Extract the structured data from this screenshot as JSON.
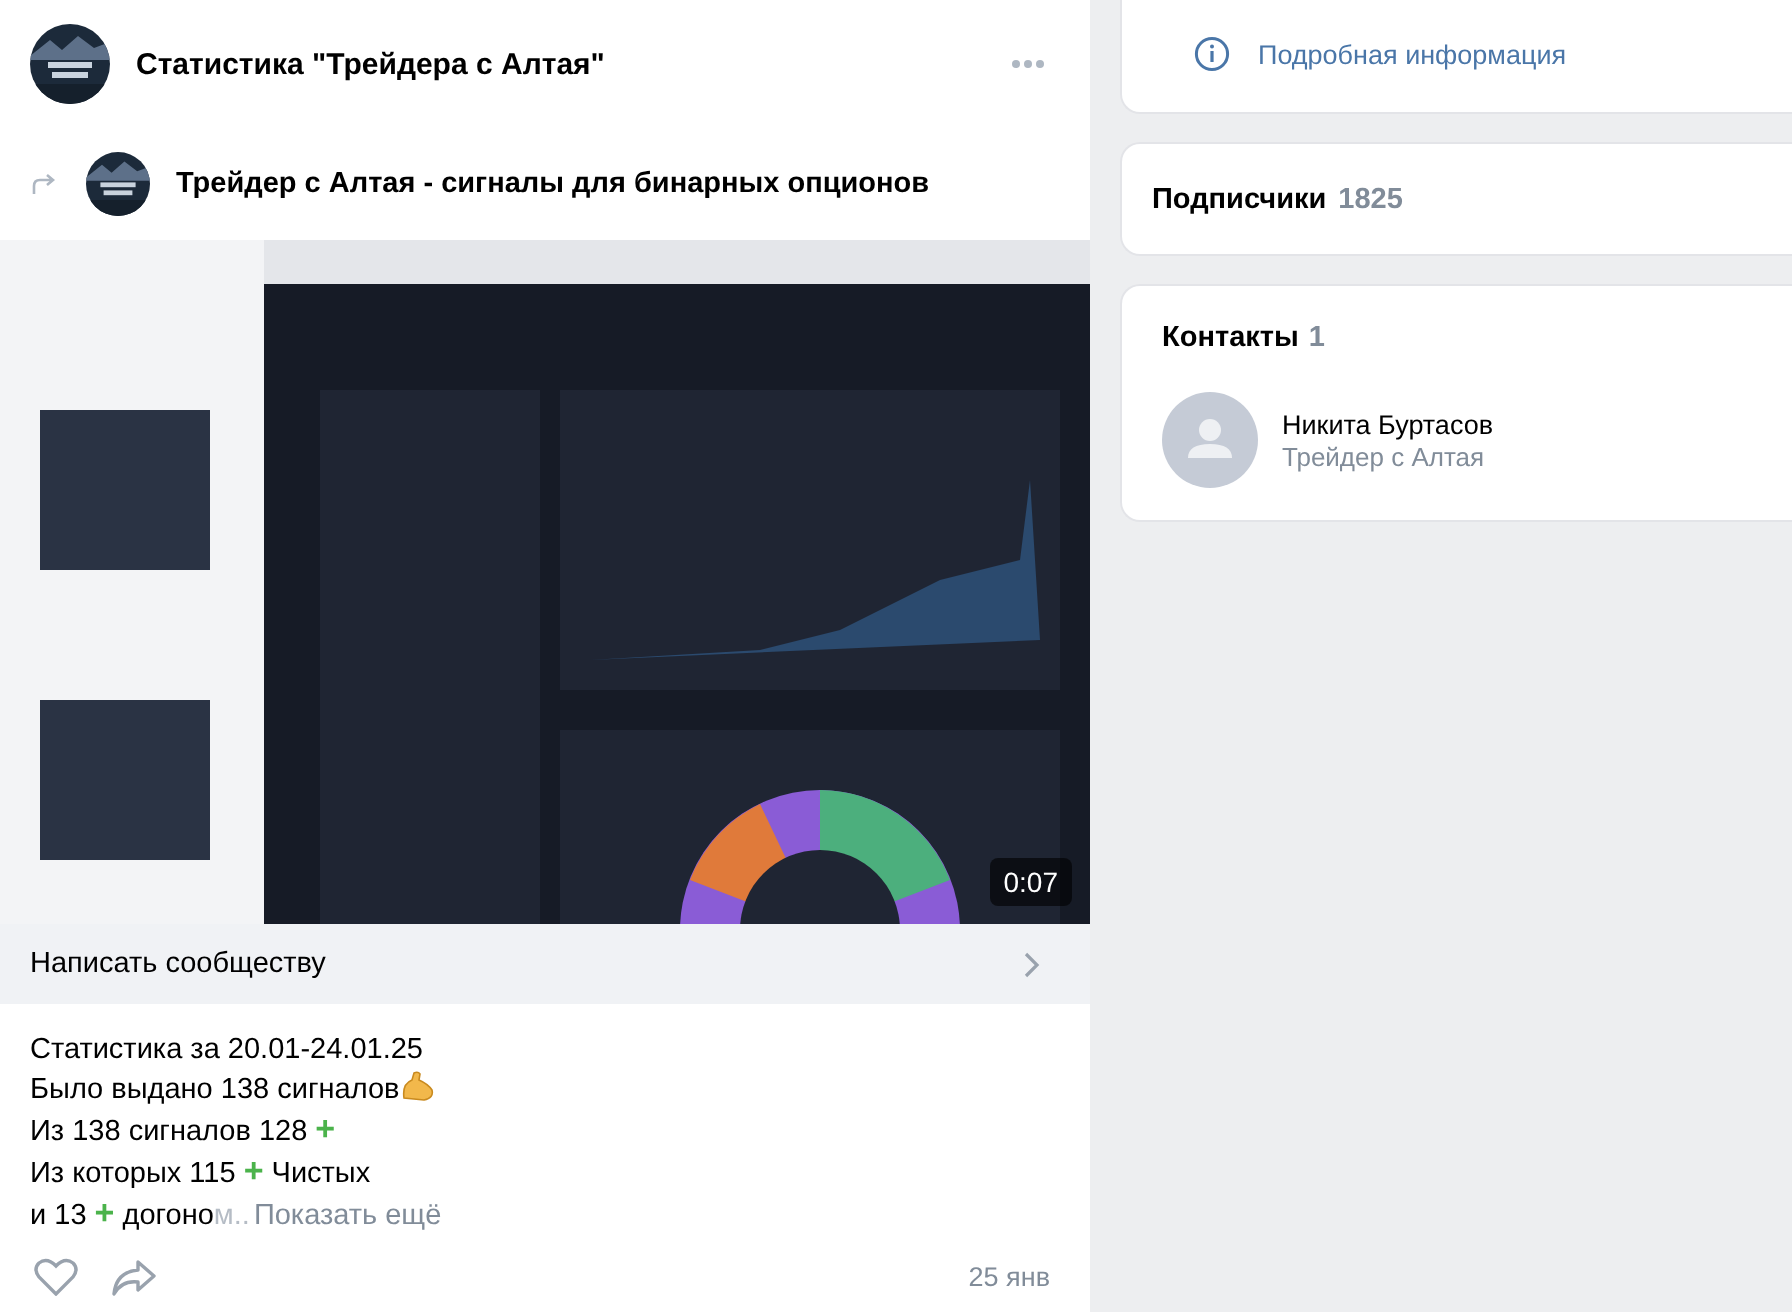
{
  "post": {
    "title": "Статистика \"Трейдера с Алтая\"",
    "repost": {
      "source": "Трейдер с Алтая - сигналы для бинарных опционов"
    },
    "video": {
      "kind": "picture",
      "duration": "0:07"
    },
    "message_bar": {
      "label": "Написать сообществу"
    },
    "text_lines": [
      [
        {
          "kind": "plain",
          "text": "Статистика за 20.01-24.01.25"
        }
      ],
      [
        {
          "kind": "plain",
          "text": "Было выдано 138 сигналов"
        },
        {
          "kind": "arm"
        }
      ],
      [
        {
          "kind": "plain",
          "text": "Из 138 сигналов 128 "
        },
        {
          "kind": "plus",
          "text": "+"
        }
      ],
      [
        {
          "kind": "plain",
          "text": "Из которых 115 "
        },
        {
          "kind": "plus",
          "text": "+"
        },
        {
          "kind": "plain",
          "text": " Чистых"
        }
      ],
      [
        {
          "kind": "plain",
          "text": "и 13 "
        },
        {
          "kind": "plus",
          "text": "+"
        },
        {
          "kind": "plain",
          "text": " догоно"
        },
        {
          "kind": "fade",
          "text": "м.."
        }
      ]
    ],
    "show_more": "Показать ещё",
    "date": "25 янв"
  },
  "sidebar": {
    "info_link": "Подробная информация",
    "subscribers": {
      "label": "Подписчики",
      "count": "1825"
    },
    "contacts": {
      "label": "Контакты",
      "count": "1",
      "items": [
        {
          "name": "Никита Буртасов",
          "role": "Трейдер с Алтая"
        }
      ]
    }
  }
}
